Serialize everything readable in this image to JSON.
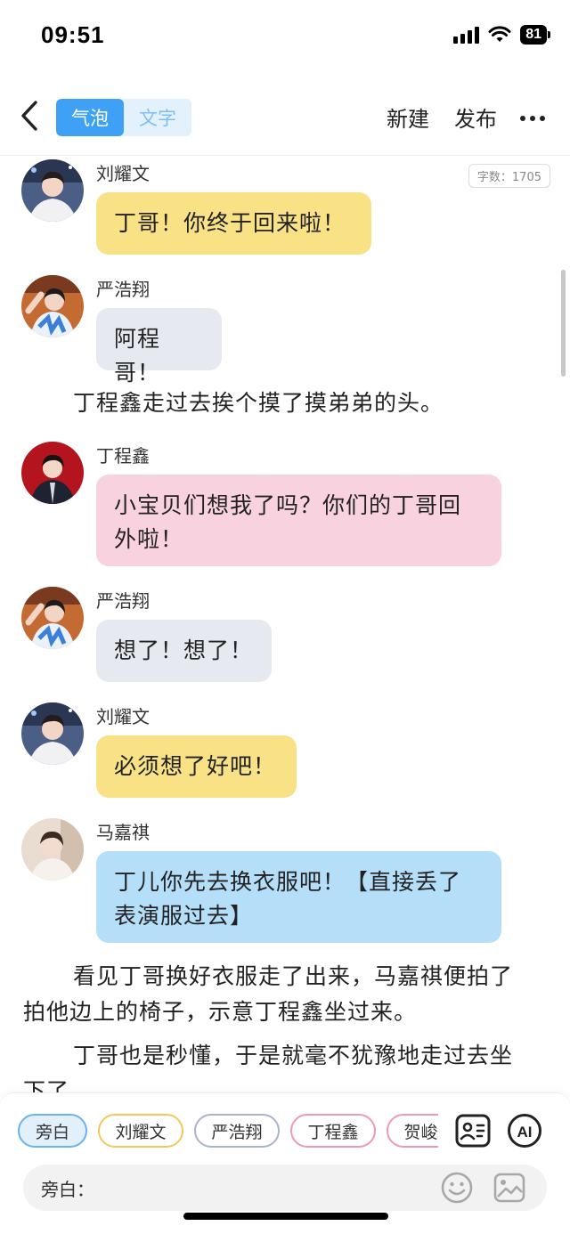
{
  "status": {
    "time": "09:51",
    "battery": "81"
  },
  "nav": {
    "tabs": [
      {
        "label": "气泡",
        "active": true
      },
      {
        "label": "文字",
        "active": false
      }
    ],
    "new_label": "新建",
    "publish_label": "发布"
  },
  "word_count": "字数：1705",
  "messages": [
    {
      "sender": "刘耀文",
      "text": "丁哥！你终于回来啦！",
      "color": "#f9e186"
    },
    {
      "sender": "严浩翔",
      "text": "阿程哥！",
      "color": "#e6e9ef"
    },
    {
      "sender": "丁程鑫",
      "text": "小宝贝们想我了吗？你们的丁哥回外啦！",
      "color": "#f8d2de"
    },
    {
      "sender": "严浩翔",
      "text": "想了！想了！",
      "color": "#e6e9ef"
    },
    {
      "sender": "刘耀文",
      "text": "必须想了好吧！",
      "color": "#f9e186"
    },
    {
      "sender": "马嘉祺",
      "text": "丁儿你先去换衣服吧！【直接丢了表演服过去】",
      "color": "#b5def9"
    }
  ],
  "narrations": [
    "丁程鑫走过去挨个摸了摸弟弟的头。",
    "看见丁哥换好衣服走了出来，马嘉祺便拍了拍他边上的椅子，示意丁程鑫坐过来。",
    "丁哥也是秒懂，于是就毫不犹豫地走过去坐下了。"
  ],
  "roles": [
    "旁白",
    "刘耀文",
    "严浩翔",
    "丁程鑫",
    "贺峻霖"
  ],
  "input": {
    "label": "旁白："
  },
  "icons": [
    "back-icon",
    "more-icon",
    "role-card-icon",
    "ai-icon",
    "emoji-icon",
    "image-icon"
  ]
}
